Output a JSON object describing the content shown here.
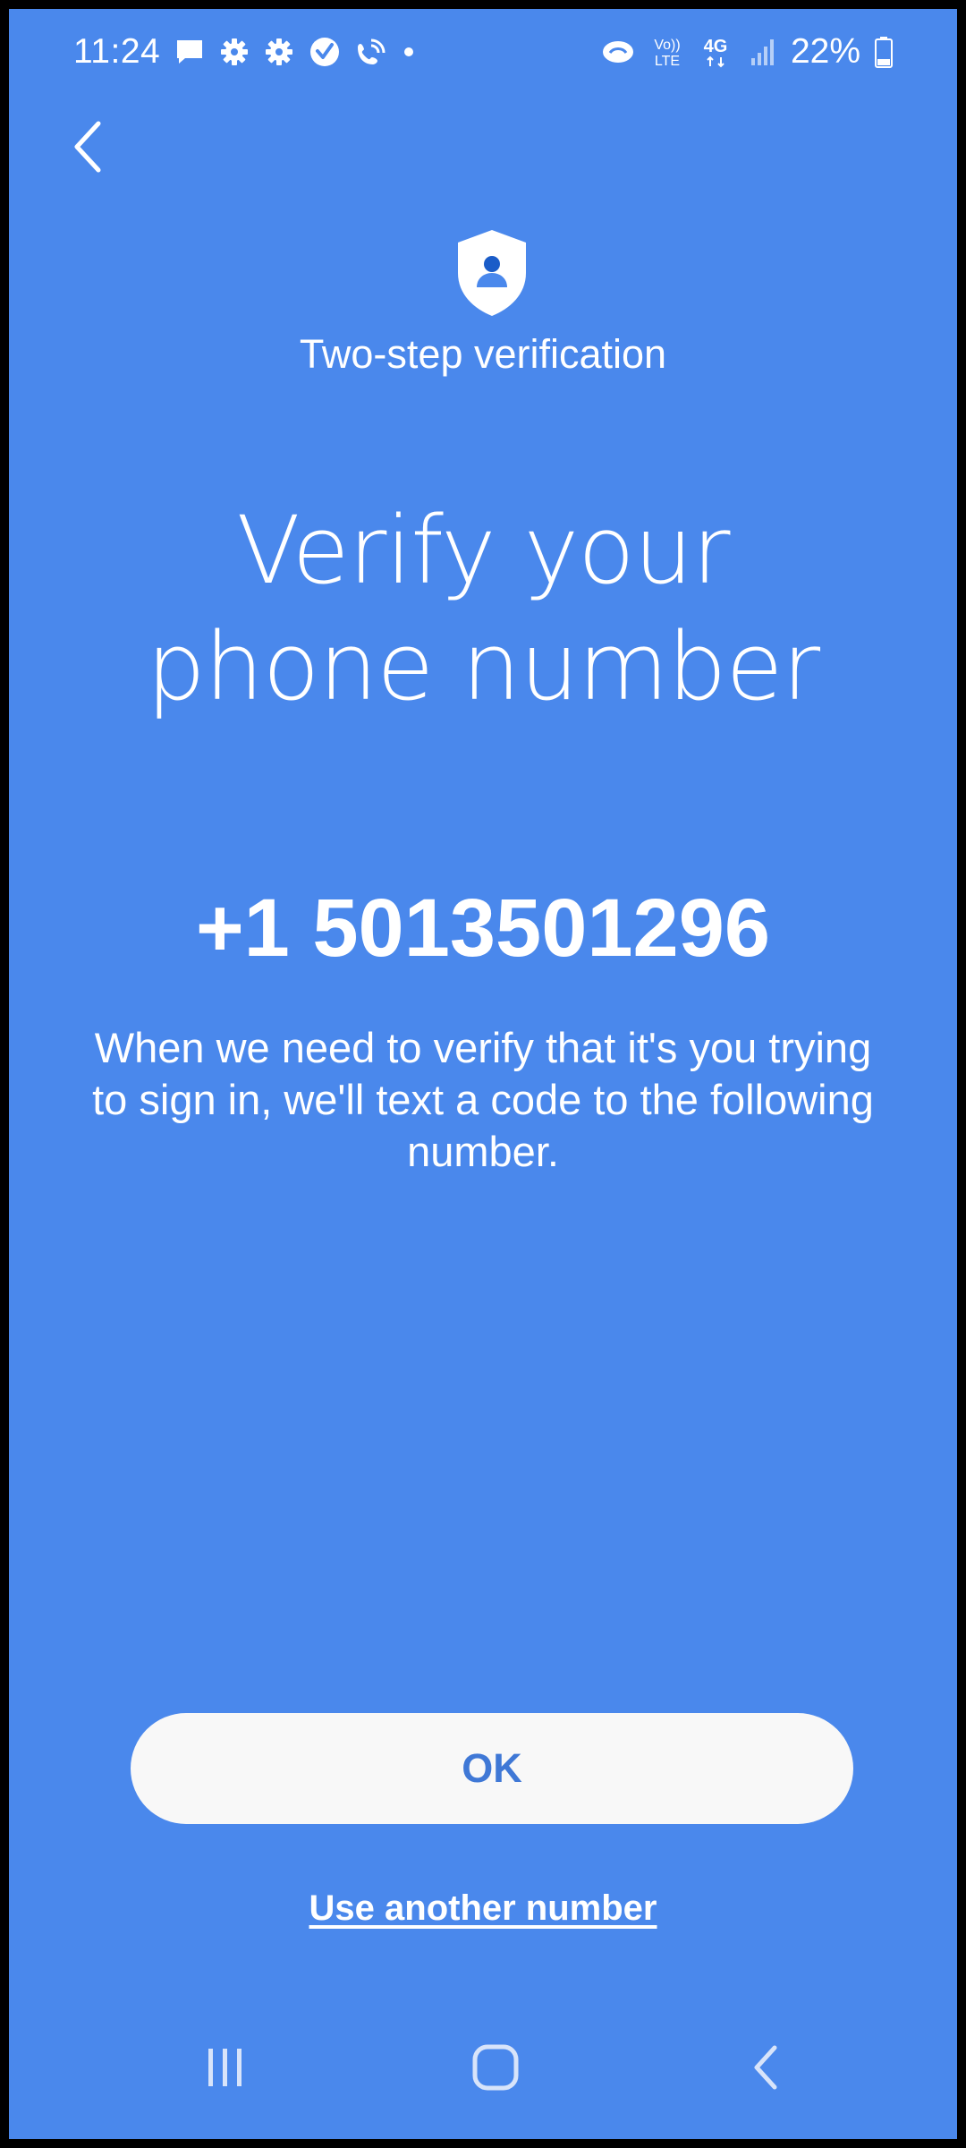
{
  "status_bar": {
    "time": "11:24",
    "network_top": "Vo))",
    "network_bottom": "LTE",
    "network_type": "4G",
    "battery": "22%",
    "left_icons": [
      "message-icon",
      "gear-icon",
      "gear-icon",
      "check-badge-icon",
      "wifi-call-icon",
      "dot-icon"
    ],
    "right_icons": [
      "sync-icon",
      "volte-icon",
      "4g-icon",
      "signal-icon",
      "battery-icon"
    ]
  },
  "header": {
    "title": "Two-step verification",
    "icon": "shield-person-icon"
  },
  "main": {
    "title_line1": "Verify your",
    "title_line2": "phone number",
    "phone_number": "+1 5013501296",
    "description": "When we need to verify that it's you trying to sign in, we'll text a code to the following number."
  },
  "actions": {
    "ok_label": "OK",
    "another_number_label": "Use another number"
  },
  "nav": {
    "icons": [
      "recent-apps-icon",
      "home-icon",
      "back-icon"
    ]
  },
  "colors": {
    "background": "#4a88ec",
    "button_bg": "#f8f8f8",
    "button_text": "#3f78d6",
    "text": "#ffffff"
  }
}
